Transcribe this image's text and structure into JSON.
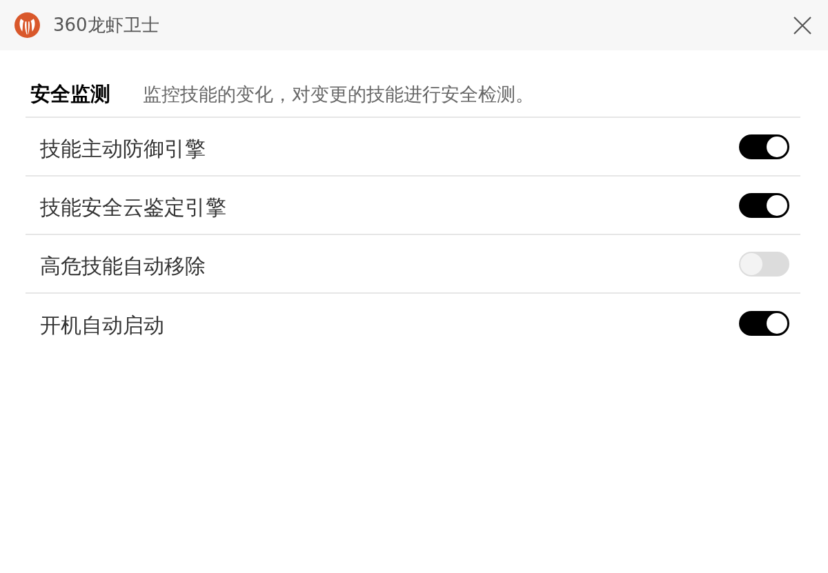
{
  "window": {
    "title": "360龙虾卫士"
  },
  "section": {
    "title": "安全监测",
    "description": "监控技能的变化，对变更的技能进行安全检测。"
  },
  "settings": [
    {
      "label": "技能主动防御引擎",
      "on": true
    },
    {
      "label": "技能安全云鉴定引擎",
      "on": true
    },
    {
      "label": "高危技能自动移除",
      "on": false
    },
    {
      "label": "开机自动启动",
      "on": true
    }
  ]
}
